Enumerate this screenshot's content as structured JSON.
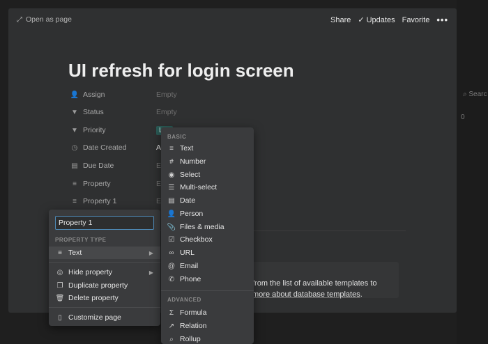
{
  "background": {
    "search_label": "Searc",
    "zero_value": "0",
    "tick_mark": "‹"
  },
  "topbar": {
    "open_as_page": "Open as page",
    "share": "Share",
    "updates": "Updates",
    "favorite": "Favorite",
    "more": "•••"
  },
  "page": {
    "title": "UI refresh for login screen",
    "properties": [
      {
        "name": "Assign",
        "value": "Empty",
        "icon": "person-icon"
      },
      {
        "name": "Status",
        "value": "Empty",
        "icon": "status-icon"
      },
      {
        "name": "Priority",
        "value": "Lov",
        "icon": "priority-icon"
      },
      {
        "name": "Date Created",
        "value": "Apr",
        "icon": "clock-icon"
      },
      {
        "name": "Due Date",
        "value": "Emp",
        "icon": "calendar-icon"
      },
      {
        "name": "Property",
        "value": "Emp",
        "icon": "text-lines-icon"
      },
      {
        "name": "Property 1",
        "value": "Emp",
        "icon": "text-lines-icon"
      }
    ],
    "template_text_1": "from the list of available templates to",
    "template_text_2_link": "more about database templates",
    "template_text_2_end": "."
  },
  "property_menu": {
    "name_value": "Property 1",
    "section_label": "PROPERTY TYPE",
    "type_label": "Text",
    "hide_label": "Hide property",
    "duplicate_label": "Duplicate property",
    "delete_label": "Delete property",
    "customize_label": "Customize page"
  },
  "type_menu": {
    "basic_label": "BASIC",
    "basic_items": [
      "Text",
      "Number",
      "Select",
      "Multi-select",
      "Date",
      "Person",
      "Files & media",
      "Checkbox",
      "URL",
      "Email",
      "Phone"
    ],
    "advanced_label": "ADVANCED",
    "advanced_items": [
      "Formula",
      "Relation",
      "Rollup"
    ]
  },
  "colors": {
    "modal_bg": "#2f3031",
    "menu_bg": "#3a3b3d",
    "tag_bg": "#2a5a55",
    "input_border": "#4f8bb8"
  }
}
